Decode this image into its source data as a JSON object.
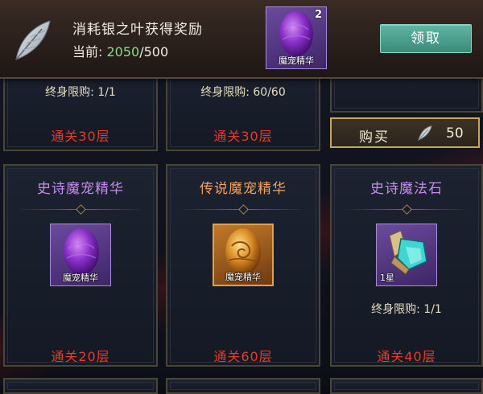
{
  "banner": {
    "title": "消耗银之叶获得奖励",
    "progress_label": "当前:",
    "progress_current": "2050",
    "progress_total": "/500",
    "item_count": "2",
    "item_label": "魔宠精华",
    "claim_label": "领取"
  },
  "top_row": [
    {
      "limit": "终身限购: 1/1",
      "stage": "通关30层"
    },
    {
      "limit": "终身限购: 60/60",
      "stage": "通关30层"
    },
    {
      "stage": ""
    }
  ],
  "buy_button": {
    "label": "购买",
    "price": "50"
  },
  "cards": [
    {
      "title": "史诗魔宠精华",
      "item_label": "魔宠精华",
      "stage": "通关20层"
    },
    {
      "title": "传说魔宠精华",
      "item_label": "魔宠精华",
      "stage": "通关60层"
    },
    {
      "title": "史诗魔法石",
      "item_label": "1星",
      "limit": "终身限购: 1/1",
      "stage": "通关40层"
    }
  ],
  "colors": {
    "title_purple": "#c78bf2",
    "title_orange": "#f2a25a",
    "stage_red": "#e83a2a",
    "claim_teal": "#4fa190",
    "progress_green": "#7fe08a"
  },
  "icons": [
    "silver-feather-icon",
    "purple-egg-icon",
    "golden-egg-icon",
    "magic-stone-icon"
  ]
}
